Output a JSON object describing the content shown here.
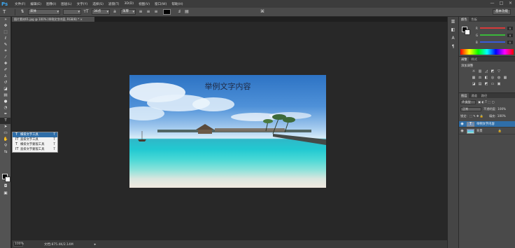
{
  "menubar": {
    "logo": "Ps",
    "items": [
      "文件(F)",
      "编辑(E)",
      "图像(I)",
      "图层(L)",
      "文字(Y)",
      "选择(S)",
      "滤镜(T)",
      "3D(D)",
      "视图(V)",
      "窗口(W)",
      "帮助(H)"
    ],
    "window_controls": [
      "—",
      "□",
      "×"
    ]
  },
  "options": {
    "tool_glyph": "T",
    "orient_glyph": "⇅",
    "font_family": "宋体",
    "font_size": "36点",
    "antialias": "浑厚",
    "color_hex": "#000000",
    "workspace": "基本功能"
  },
  "document": {
    "tab_label": "图片素材01.jpg @ 100% (举例文字内容, RGB/8) * ×",
    "canvas_text": "举例文字内容"
  },
  "flyout": {
    "items": [
      {
        "glyph": "T",
        "label": "横排文字工具",
        "shortcut": "T"
      },
      {
        "glyph": "IT",
        "label": "直排文字工具",
        "shortcut": "T"
      },
      {
        "glyph": "T",
        "label": "横排文字蒙版工具",
        "shortcut": "T"
      },
      {
        "glyph": "IT",
        "label": "直排文字蒙版工具",
        "shortcut": "T"
      }
    ]
  },
  "status": {
    "zoom": "100%",
    "doc_size": "文档:875.4K/2.14M",
    "arrow": "▸"
  },
  "color_panel": {
    "tabs": [
      "颜色",
      "色板"
    ],
    "sliders": [
      {
        "label": "R",
        "value": "0",
        "color": "#d83a3a"
      },
      {
        "label": "G",
        "value": "0",
        "color": "#3ab83a"
      },
      {
        "label": "B",
        "value": "0",
        "color": "#3a5ad8"
      }
    ]
  },
  "adjustments_panel": {
    "tabs": [
      "调整",
      "样式"
    ],
    "title": "添加调整"
  },
  "layers_panel": {
    "tabs": [
      "图层",
      "通道",
      "路径"
    ],
    "kind_filter": "P 类型",
    "blend_mode": "正常",
    "opacity_label": "不透明度:",
    "opacity_value": "100%",
    "lock_label": "锁定:",
    "fill_label": "填充:",
    "fill_value": "100%",
    "layers": [
      {
        "name": "举例文字内容",
        "type": "text",
        "selected": true
      },
      {
        "name": "背景",
        "type": "image",
        "selected": false
      }
    ]
  }
}
